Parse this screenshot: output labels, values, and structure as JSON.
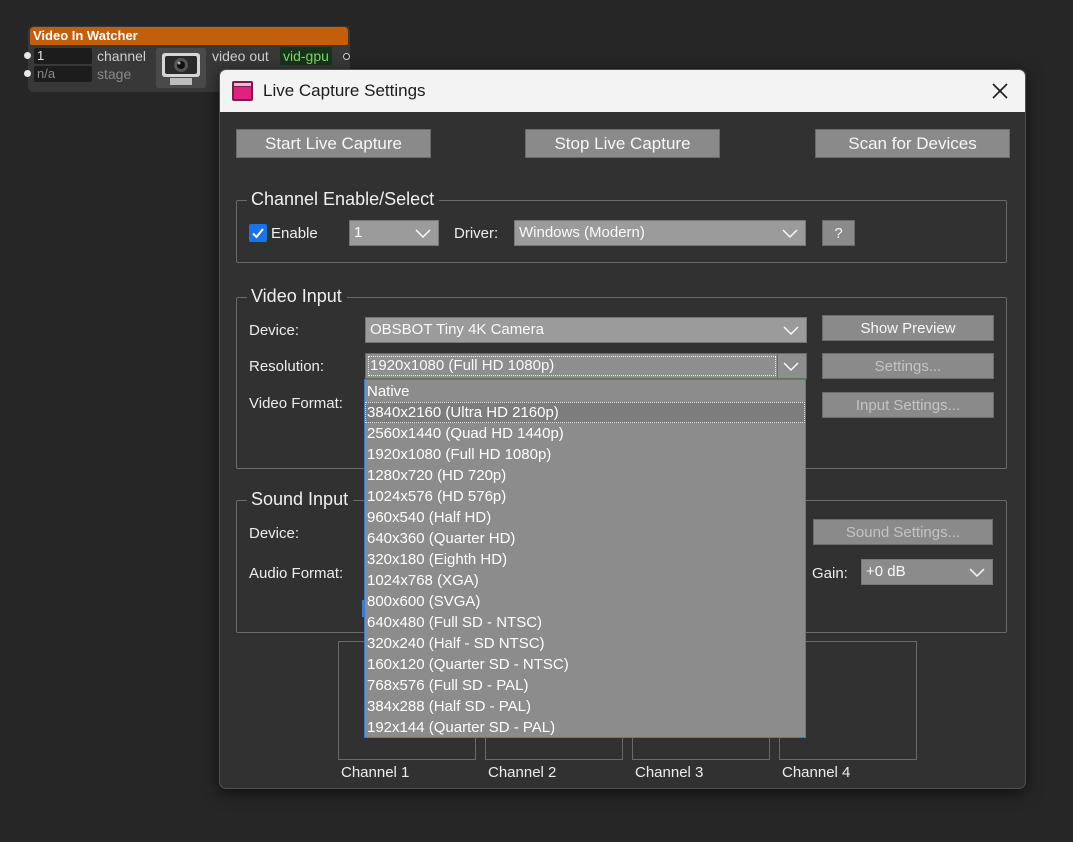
{
  "node": {
    "title": "Video In Watcher",
    "channel_value": "1",
    "channel_label": "channel",
    "stage_value": "n/a",
    "stage_label": "stage",
    "out_label": "video out",
    "out_value": "vid-gpu"
  },
  "dialog": {
    "title": "Live Capture Settings",
    "buttons": {
      "start": "Start Live Capture",
      "stop": "Stop Live Capture",
      "scan": "Scan for Devices"
    },
    "channel_group": {
      "title": "Channel Enable/Select",
      "enable_label": "Enable",
      "enable_checked": true,
      "channel_value": "1",
      "driver_label": "Driver:",
      "driver_value": "Windows (Modern)",
      "help_label": "?"
    },
    "video_group": {
      "title": "Video Input",
      "device_label": "Device:",
      "device_value": "OBSBOT Tiny 4K Camera",
      "show_preview": "Show Preview",
      "resolution_label": "Resolution:",
      "resolution_value": "1920x1080 (Full HD 1080p)",
      "settings": "Settings...",
      "format_label": "Video Format:",
      "input_settings": "Input Settings..."
    },
    "sound_group": {
      "title": "Sound Input",
      "device_label": "Device:",
      "sound_settings": "Sound Settings...",
      "format_label": "Audio Format:",
      "gain_label": "Gain:",
      "gain_value": "+0 dB"
    },
    "preview": {
      "channels": [
        "Channel 1",
        "Channel 2",
        "Channel 3",
        "Channel 4"
      ]
    }
  },
  "resolution_dropdown": {
    "hover_index": 1,
    "options": [
      "Native",
      "3840x2160 (Ultra HD 2160p)",
      "2560x1440 (Quad HD 1440p)",
      "1920x1080 (Full HD 1080p)",
      "1280x720 (HD 720p)",
      "1024x576 (HD 576p)",
      "960x540 (Half HD)",
      "640x360 (Quarter HD)",
      "320x180 (Eighth HD)",
      "1024x768 (XGA)",
      "800x600 (SVGA)",
      "640x480 (Full SD - NTSC)",
      "320x240 (Half - SD NTSC)",
      "160x120 (Quarter SD - NTSC)",
      "768x576 (Full SD - PAL)",
      "384x288 (Half SD - PAL)",
      "192x144 (Quarter SD - PAL)"
    ]
  }
}
